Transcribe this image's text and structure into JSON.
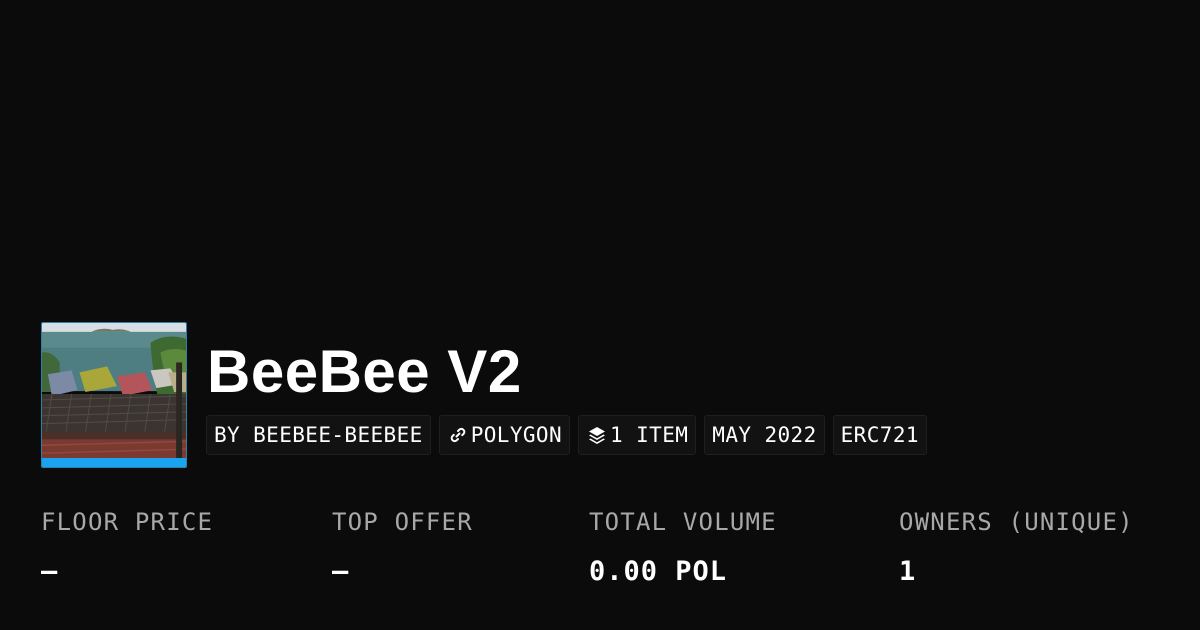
{
  "collection": {
    "name": "BeeBee V2",
    "avatar_icon": "collection-avatar-image"
  },
  "chips": {
    "creator": "BY BEEBEE-BEEBEE",
    "chain": "POLYGON",
    "chain_icon": "link-icon",
    "items": "1 ITEM",
    "items_icon": "layers-icon",
    "created": "MAY 2022",
    "standard": "ERC721"
  },
  "stats": {
    "floor_price": {
      "label": "FLOOR PRICE",
      "value": "—"
    },
    "top_offer": {
      "label": "TOP OFFER",
      "value": "—"
    },
    "total_volume": {
      "label": "TOTAL VOLUME",
      "value": "0.00 POL"
    },
    "owners": {
      "label": "OWNERS (UNIQUE)",
      "value": "1"
    }
  },
  "colors": {
    "background": "#0b0b0b",
    "avatar_accent": "#1aa3ef",
    "label_gray": "#a8a8a8"
  }
}
